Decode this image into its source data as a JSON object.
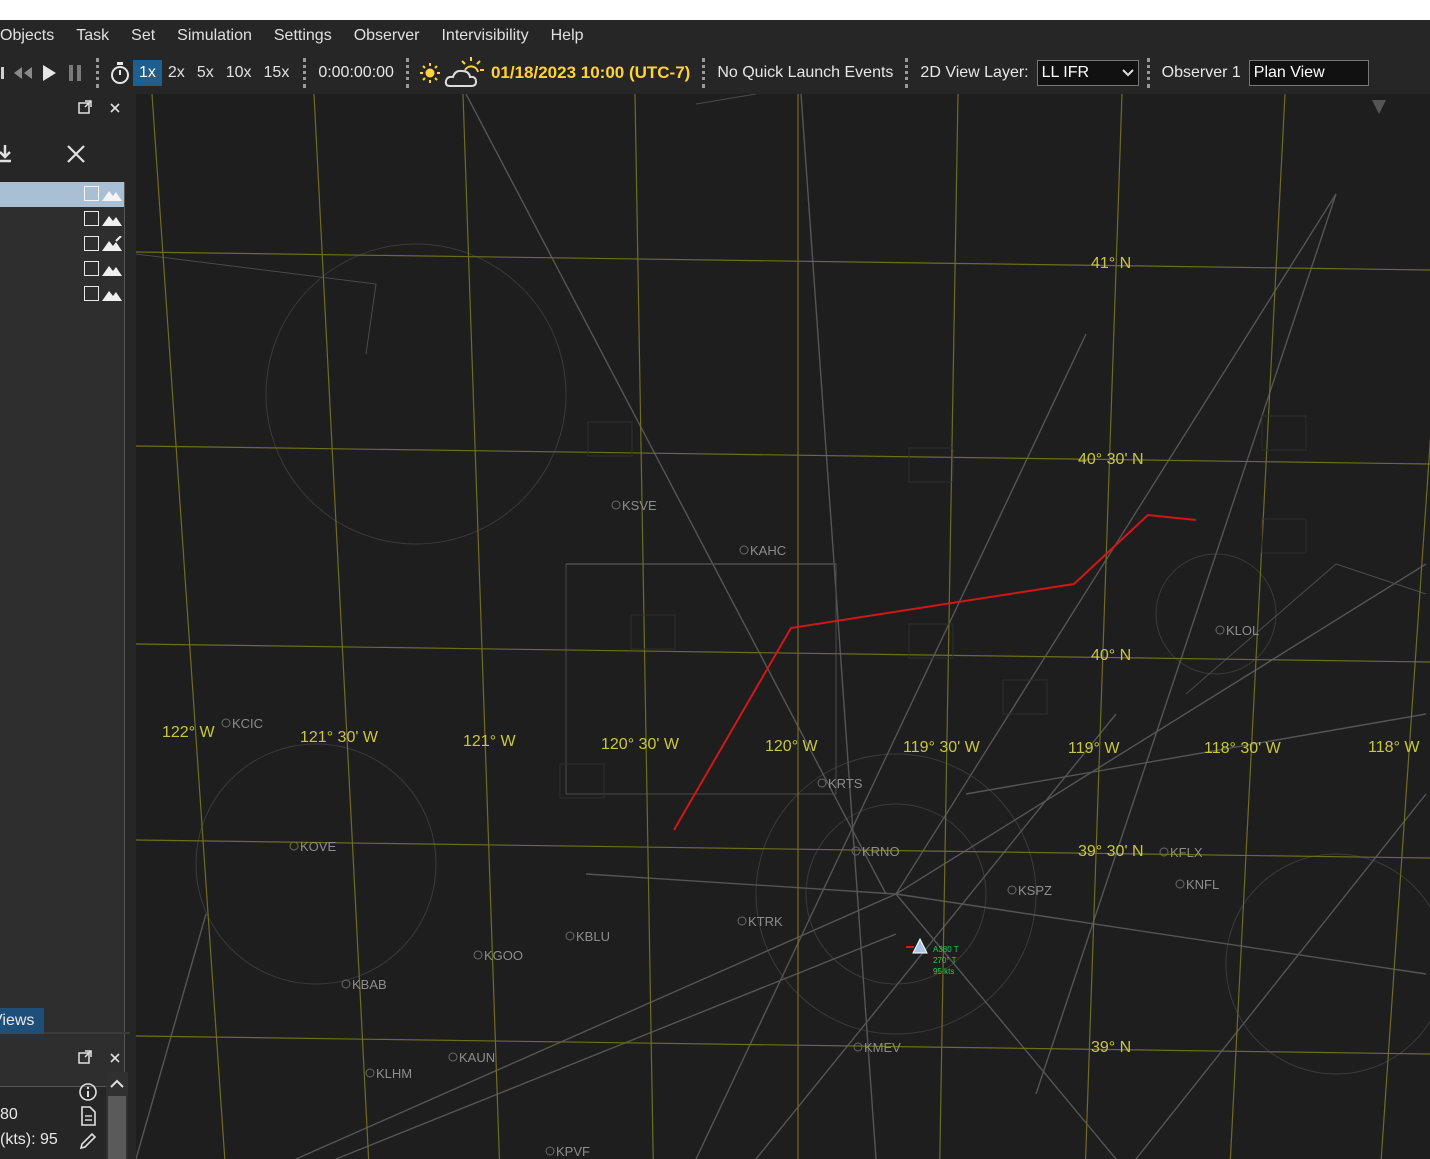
{
  "menu": [
    "Objects",
    "Task",
    "Set",
    "Simulation",
    "Settings",
    "Observer",
    "Intervisibility",
    "Help"
  ],
  "toolbar": {
    "speeds": [
      "1x",
      "2x",
      "5x",
      "10x",
      "15x"
    ],
    "active_speed": "1x",
    "elapsed": "0:00:00:00",
    "datetime": "01/18/2023 10:00 (UTC-7)",
    "quick_launch": "No Quick Launch Events",
    "view_layer_label": "2D View Layer:",
    "view_layer_value": "LL IFR",
    "observer_label": "Observer 1",
    "observer_value": "Plan View"
  },
  "left_panel": {
    "layer_count": 5,
    "views_tab": "Views",
    "props": {
      "line1": "80",
      "line2": "(kts): 95"
    }
  },
  "map": {
    "lat_labels": [
      "41° N",
      "40° 30' N",
      "40° N",
      "39° 30' N",
      "39° N"
    ],
    "lon_labels": [
      "122° W",
      "121° 30' W",
      "121° W",
      "120° 30' W",
      "120° W",
      "119° 30' W",
      "119° W",
      "118° 30' W",
      "118° W"
    ],
    "airports": [
      "KCIC",
      "KOVE",
      "KSVE",
      "KAHC",
      "KTRK",
      "KRTS",
      "KRNO",
      "KSPZ",
      "KGOO",
      "KBLU",
      "KBAB",
      "KAUN",
      "KLHM",
      "KMEV",
      "KLOL",
      "KFLX",
      "KNFL",
      "KPVF"
    ],
    "aircraft_tag": [
      "A380 T",
      "270° T",
      "95 kts"
    ],
    "colors": {
      "grid": "#8a8a2a",
      "route": "#d01818",
      "label": "#c9c83a",
      "aircraft": "#22d04a"
    }
  }
}
